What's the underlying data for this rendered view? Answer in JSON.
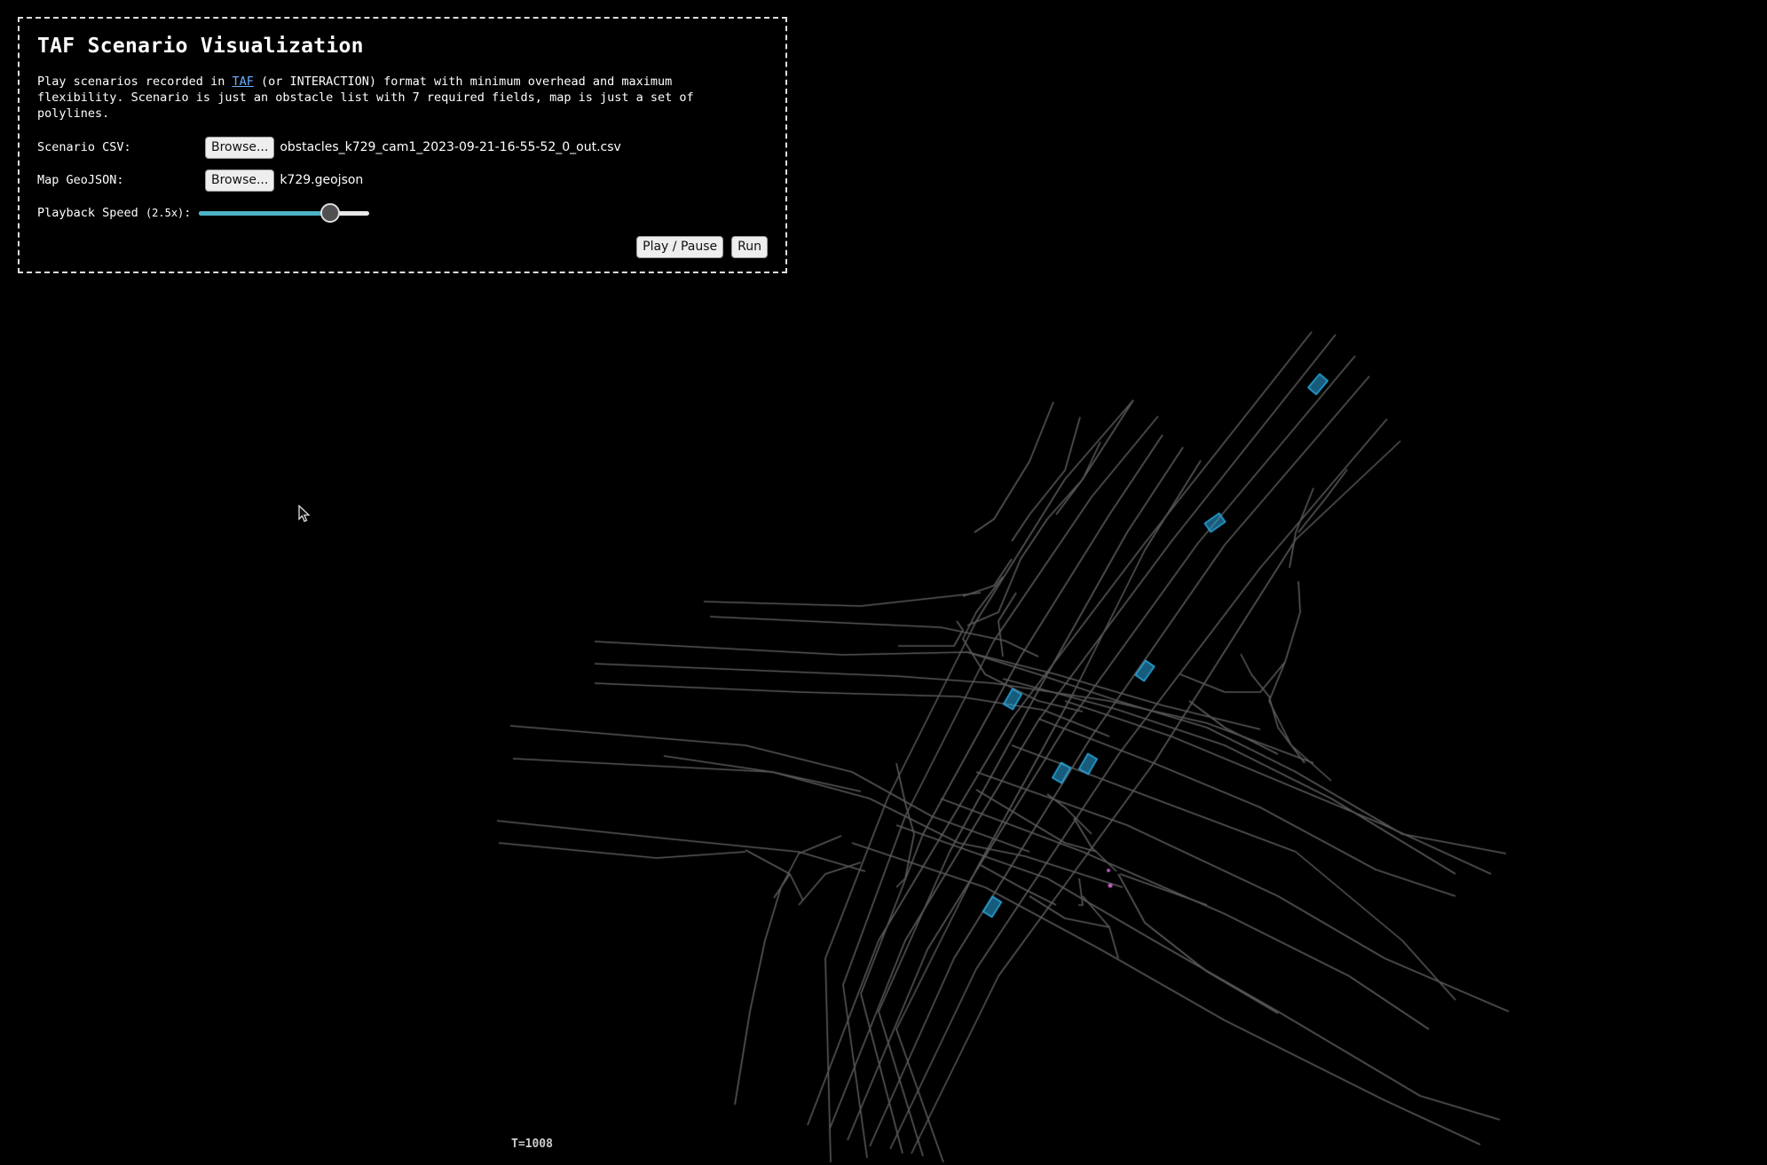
{
  "panel": {
    "title": "TAF Scenario Visualization",
    "description": {
      "before_link": "Play scenarios recorded in ",
      "link_text": "TAF",
      "after_link": " (or INTERACTION) format with minimum overhead and maximum flexibility. Scenario is just an obstacle list with 7 required fields, map is just a set of polylines."
    },
    "scenario": {
      "label": "Scenario CSV:",
      "browse_label": "Browse...",
      "file_name": "obstacles_k729_cam1_2023-09-21-16-55-52_0_out.csv"
    },
    "map": {
      "label": "Map GeoJSON:",
      "browse_label": "Browse...",
      "file_name": "k729.geojson"
    },
    "speed": {
      "label": "Playback Speed",
      "value_text": "(2.5x)",
      "suffix": ":",
      "fraction": 0.77
    },
    "play_pause_label": "Play / Pause",
    "run_label": "Run"
  },
  "status": {
    "time_label": "T=1008"
  },
  "colors": {
    "background": "#000000",
    "lane": "#5a5a5a",
    "vehicle": "#29a8e0",
    "pedestrian": "#c060c0",
    "accent": "#4fb3c7"
  }
}
